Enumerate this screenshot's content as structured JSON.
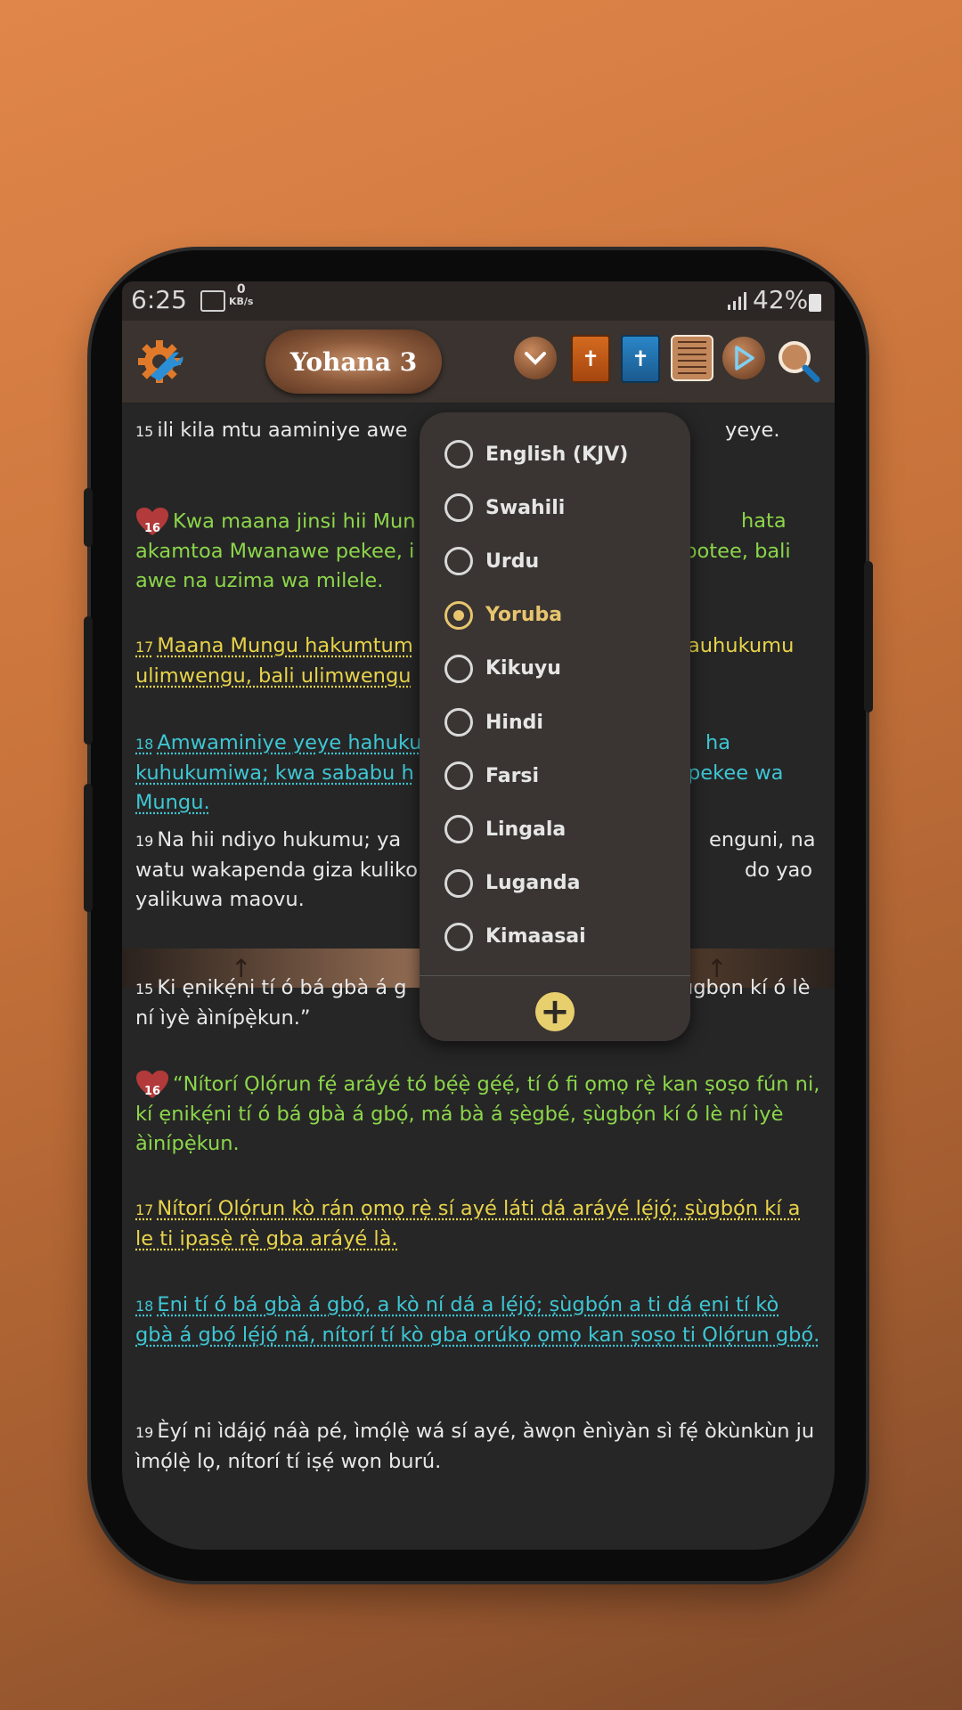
{
  "status_bar": {
    "time": "6:25",
    "kbs_value": "0",
    "kbs_unit": "KB/s",
    "battery": "42%"
  },
  "toolbar": {
    "title": "Yohana 3"
  },
  "top_verses": [
    {
      "num": "15",
      "text": "ili kila mtu aaminiye awe",
      "tail": "yeye.",
      "style": "plain"
    },
    {
      "num": "16",
      "text": "Kwa maana jinsi hii Mun",
      "tail": "hata",
      "line2": "akamtoa Mwanawe pekee, i",
      "line2_tail": "ipotee, bali",
      "line3": "awe na uzima wa milele.",
      "style": "green"
    },
    {
      "num": "17",
      "text": "Maana Mungu hakumtum",
      "tail": "auhukumu",
      "line2": "ulimwengu, bali ulimwengu",
      "style": "yellow"
    },
    {
      "num": "18",
      "text": "Amwaminiye yeye hahuku",
      "tail": "ha",
      "line2": "kuhukumiwa; kwa sababu h",
      "line2_tail": "pekee wa",
      "line3": "Mungu.",
      "style": "cyan"
    },
    {
      "num": "19",
      "text": "Na hii ndiyo hukumu; ya",
      "tail": "enguni, na",
      "line2": "watu wakapenda giza kuliko",
      "line2_tail": "do yao",
      "line3": "yalikuwa maovu.",
      "style": "plain"
    }
  ],
  "bottom_verses": [
    {
      "num": "15",
      "text": "Ki ẹnikẹ́ni tí ó bá gbà á g",
      "tail": "ugbọn kí ó lè",
      "line2": "ní ìyè àìnípẹ̀kun.”",
      "style": "plain"
    },
    {
      "num": "16",
      "text": "“Nítorí Ọlọ́run fẹ́ aráyé tó bẹ́ẹ̀ gẹ́ẹ́, tí ó fi ọmọ rẹ̀ kan ṣoṣo fún ni, kí ẹnikẹ́ni tí ó bá gbà á gbọ́, má bà á ṣègbé, ṣùgbọ́n kí ó lè ní ìyè àìnípẹ̀kun.",
      "style": "green"
    },
    {
      "num": "17",
      "text": "Nítorí Ọlọ́run kò rán ọmọ rẹ̀ sí ayé láti dá aráyé lẹ́jọ́; ṣùgbọ́n kí a le ti ipasẹ̀ rẹ̀ gba aráyé là.",
      "style": "yellow"
    },
    {
      "num": "18",
      "text": "Ẹni tí ó bá gbà á gbọ́, a kò ní dá a lẹ́jọ́; ṣùgbọ́n a ti dá ẹni tí kò gbà á gbọ́ lẹ́jọ́ ná, nítorí tí kò gba orúkọ ọmọ kan ṣoṣo ti Ọlọ́run gbọ́.",
      "style": "cyan"
    },
    {
      "num": "19",
      "text": "Èyí ni ìdájọ́ náà pé, ìmọ́lẹ̀ wá sí ayé, àwọn ènìyàn sì fẹ́ òkùnkùn ju ìmọ́lẹ̀ lọ, nítorí tí iṣẹ́ wọn burú.",
      "style": "plain"
    }
  ],
  "language_menu": {
    "options": [
      "English (KJV)",
      "Swahili",
      "Urdu",
      "Yoruba",
      "Kikuyu",
      "Hindi",
      "Farsi",
      "Lingala",
      "Luganda",
      "Kimaasai"
    ],
    "selected": "Yoruba"
  },
  "colors": {
    "accent": "#e8c56e",
    "verse_green": "#8cd64a",
    "verse_yellow": "#e8d34a",
    "verse_cyan": "#3ec6d4"
  }
}
